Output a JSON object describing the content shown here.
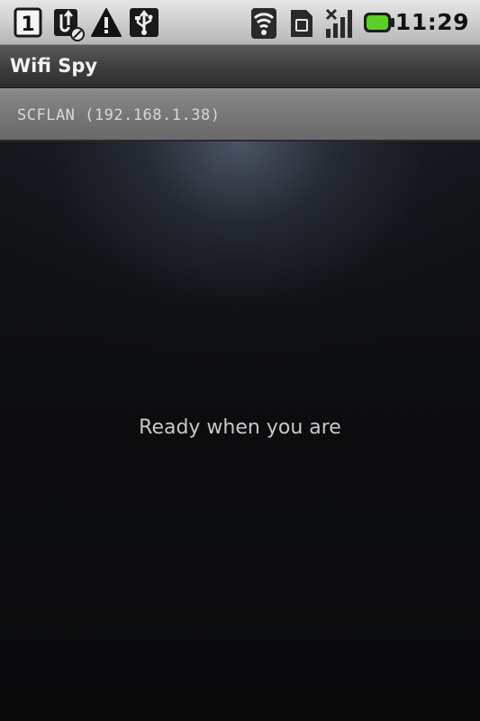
{
  "status_bar": {
    "notification_count": "1",
    "time": "11:29",
    "icons": {
      "notification": "notification-count-icon",
      "usb_debug": "usb-debugging-icon",
      "warning": "warning-icon",
      "usb": "usb-icon",
      "wifi": "wifi-signal-icon",
      "sim": "sim-card-icon",
      "cell": "cell-signal-icon",
      "battery": "battery-icon"
    },
    "colors": {
      "battery": "#5bd126"
    }
  },
  "app": {
    "title": "Wifi Spy"
  },
  "network": {
    "label": "SCFLAN (192.168.1.38)"
  },
  "content": {
    "message": "Ready when you are"
  }
}
